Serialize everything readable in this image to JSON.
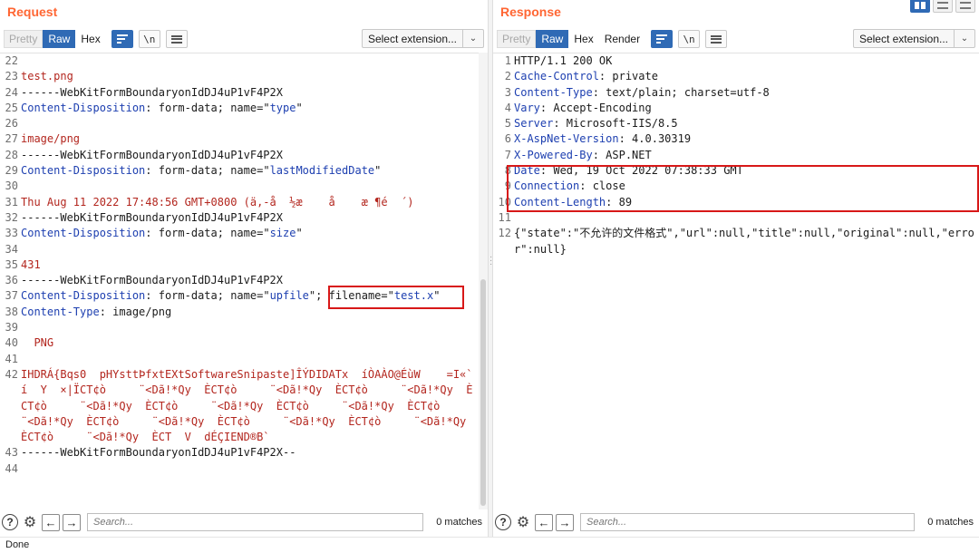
{
  "request": {
    "title": "Request",
    "tabs": {
      "pretty": "Pretty",
      "raw": "Raw",
      "hex": "Hex"
    },
    "newline_toggle": "\\n",
    "extension_select": "Select extension...",
    "lines": [
      {
        "n": "22",
        "parts": []
      },
      {
        "n": "23",
        "parts": [
          {
            "c": "red",
            "t": "test.png"
          }
        ]
      },
      {
        "n": "24",
        "parts": [
          {
            "c": "plain",
            "t": "------WebKitFormBoundaryonIdDJ4uP1vF4P2X"
          }
        ]
      },
      {
        "n": "25",
        "parts": [
          {
            "c": "hname",
            "t": "Content-Disposition"
          },
          {
            "c": "plain",
            "t": ": form-data; name=\""
          },
          {
            "c": "attr",
            "t": "type"
          },
          {
            "c": "plain",
            "t": "\""
          }
        ]
      },
      {
        "n": "26",
        "parts": []
      },
      {
        "n": "27",
        "parts": [
          {
            "c": "red",
            "t": "image/png"
          }
        ]
      },
      {
        "n": "28",
        "parts": [
          {
            "c": "plain",
            "t": "------WebKitFormBoundaryonIdDJ4uP1vF4P2X"
          }
        ]
      },
      {
        "n": "29",
        "parts": [
          {
            "c": "hname",
            "t": "Content-Disposition"
          },
          {
            "c": "plain",
            "t": ": form-data; name=\""
          },
          {
            "c": "attr",
            "t": "lastModifiedDate"
          },
          {
            "c": "plain",
            "t": "\""
          }
        ]
      },
      {
        "n": "30",
        "parts": []
      },
      {
        "n": "31",
        "parts": [
          {
            "c": "red",
            "t": "Thu Aug 11 2022 17:48:56 GMT+0800 (ä,-å  ½æ    å    æ ¶é  ´)"
          }
        ]
      },
      {
        "n": "32",
        "parts": [
          {
            "c": "plain",
            "t": "------WebKitFormBoundaryonIdDJ4uP1vF4P2X"
          }
        ]
      },
      {
        "n": "33",
        "parts": [
          {
            "c": "hname",
            "t": "Content-Disposition"
          },
          {
            "c": "plain",
            "t": ": form-data; name=\""
          },
          {
            "c": "attr",
            "t": "size"
          },
          {
            "c": "plain",
            "t": "\""
          }
        ]
      },
      {
        "n": "34",
        "parts": []
      },
      {
        "n": "35",
        "parts": [
          {
            "c": "red",
            "t": "431"
          }
        ]
      },
      {
        "n": "36",
        "parts": [
          {
            "c": "plain",
            "t": "------WebKitFormBoundaryonIdDJ4uP1vF4P2X"
          }
        ]
      },
      {
        "n": "37",
        "parts": [
          {
            "c": "hname",
            "t": "Content-Disposition"
          },
          {
            "c": "plain",
            "t": ": form-data; name=\""
          },
          {
            "c": "attr",
            "t": "upfile"
          },
          {
            "c": "plain",
            "t": "\"; filename=\""
          },
          {
            "c": "attr",
            "t": "test.x"
          },
          {
            "c": "plain",
            "t": "\""
          }
        ]
      },
      {
        "n": "38",
        "parts": [
          {
            "c": "hname",
            "t": "Content-Type"
          },
          {
            "c": "plain",
            "t": ": image/png"
          }
        ]
      },
      {
        "n": "39",
        "parts": []
      },
      {
        "n": "40",
        "parts": [
          {
            "c": "red",
            "t": "  PNG"
          }
        ]
      },
      {
        "n": "41",
        "parts": []
      },
      {
        "n": "42",
        "wrap": true,
        "parts": [
          {
            "c": "red",
            "t": "IHDRÁ{Bqs0  pHYsttÞfxtEXtSoftwareSnipaste]ÎÝDIDATx  íÒAÀO@ÉùW    =I«` í  Y  ×|ÏCT¢ò     ¨<Dã!*Qy  ÈCT¢ò     ¨<Dã!*Qy  ÈCT¢ò     ¨<Dã!*Qy  ÈCT¢ò     ¨<Dã!*Qy  ÈCT¢ò     ¨<Dã!*Qy  ÈCT¢ò     ¨<Dã!*Qy  ÈCT¢ò     ¨<Dã!*Qy  ÈCT¢ò     ¨<Dã!*Qy  ÈCT¢ò     ¨<Dã!*Qy  ÈCT¢ò     ¨<Dã!*Qy  ÈCT¢ò     ¨<Dã!*Qy  ÈCT  V  dÉÇIEND®B`"
          }
        ]
      },
      {
        "n": "43",
        "parts": [
          {
            "c": "plain",
            "t": "------WebKitFormBoundaryonIdDJ4uP1vF4P2X--"
          }
        ]
      },
      {
        "n": "44",
        "parts": []
      }
    ],
    "search_placeholder": "Search...",
    "matches": "0 matches"
  },
  "response": {
    "title": "Response",
    "tabs": {
      "pretty": "Pretty",
      "raw": "Raw",
      "hex": "Hex",
      "render": "Render"
    },
    "newline_toggle": "\\n",
    "extension_select": "Select extension...",
    "lines": [
      {
        "n": "1",
        "parts": [
          {
            "c": "plain",
            "t": "HTTP/1.1 200 OK"
          }
        ]
      },
      {
        "n": "2",
        "parts": [
          {
            "c": "hname",
            "t": "Cache-Control"
          },
          {
            "c": "plain",
            "t": ": private"
          }
        ]
      },
      {
        "n": "3",
        "parts": [
          {
            "c": "hname",
            "t": "Content-Type"
          },
          {
            "c": "plain",
            "t": ": text/plain; charset=utf-8"
          }
        ]
      },
      {
        "n": "4",
        "parts": [
          {
            "c": "hname",
            "t": "Vary"
          },
          {
            "c": "plain",
            "t": ": Accept-Encoding"
          }
        ]
      },
      {
        "n": "5",
        "parts": [
          {
            "c": "hname",
            "t": "Server"
          },
          {
            "c": "plain",
            "t": ": Microsoft-IIS/8.5"
          }
        ]
      },
      {
        "n": "6",
        "parts": [
          {
            "c": "hname",
            "t": "X-AspNet-Version"
          },
          {
            "c": "plain",
            "t": ": 4.0.30319"
          }
        ]
      },
      {
        "n": "7",
        "parts": [
          {
            "c": "hname",
            "t": "X-Powered-By"
          },
          {
            "c": "plain",
            "t": ": ASP.NET"
          }
        ]
      },
      {
        "n": "8",
        "parts": [
          {
            "c": "hname",
            "t": "Date"
          },
          {
            "c": "plain",
            "t": ": Wed, 19 Oct 2022 07:38:33 GMT"
          }
        ]
      },
      {
        "n": "9",
        "parts": [
          {
            "c": "hname",
            "t": "Connection"
          },
          {
            "c": "plain",
            "t": ": close"
          }
        ]
      },
      {
        "n": "10",
        "parts": [
          {
            "c": "hname",
            "t": "Content-Length"
          },
          {
            "c": "plain",
            "t": ": 89"
          }
        ]
      },
      {
        "n": "11",
        "parts": []
      },
      {
        "n": "12",
        "wrap": true,
        "parts": [
          {
            "c": "plain",
            "t": "{\"state\":\"不允许的文件格式\",\"url\":null,\"title\":null,\"original\":null,\"error\":null}"
          }
        ]
      }
    ],
    "search_placeholder": "Search...",
    "matches": "0 matches"
  },
  "status": "Done",
  "colors": {
    "accent": "#ff6633",
    "selected_tab": "#2f6ab5",
    "highlight_box": "#d81818",
    "header_name": "#1d3fb0",
    "body_red": "#b3261e"
  },
  "icons": [
    "layout-split-icon",
    "layout-horizontal-icon",
    "layout-vertical-icon",
    "word-wrap-icon",
    "newline-icon",
    "menu-icon",
    "help-icon",
    "gear-icon",
    "back-arrow-icon",
    "forward-arrow-icon",
    "chevron-down-icon"
  ]
}
